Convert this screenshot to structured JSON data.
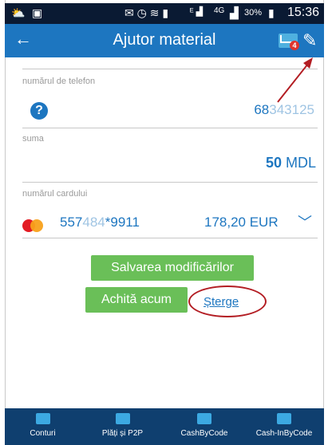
{
  "status_bar": {
    "network": "4G",
    "battery": "30%",
    "time": "15:36"
  },
  "app_bar": {
    "title": "Ajutor material",
    "mail_badge": "4"
  },
  "form": {
    "phone_label": "numărul de telefon",
    "phone_prefix": "68",
    "phone_blurred": "343125",
    "amount_label": "suma",
    "amount_value": "50",
    "amount_currency": "MDL",
    "card_label": "numărul cardului",
    "card_prefix": "557",
    "card_blurred": "484",
    "card_suffix": "*9911",
    "card_balance": "178,20 EUR"
  },
  "actions": {
    "save_label": "Salvarea modificărilor",
    "pay_label": "Achită acum",
    "delete_label": "Șterge"
  },
  "bottom_nav": [
    {
      "label": "Conturi"
    },
    {
      "label": "Plăți și P2P"
    },
    {
      "label": "CashByCode"
    },
    {
      "label": "Cash-InByCode"
    }
  ],
  "colors": {
    "app_bar": "#1d76c0",
    "primary_button": "#6abf58",
    "nav_bg": "#0f3f6f",
    "annotation": "#b31d23"
  }
}
